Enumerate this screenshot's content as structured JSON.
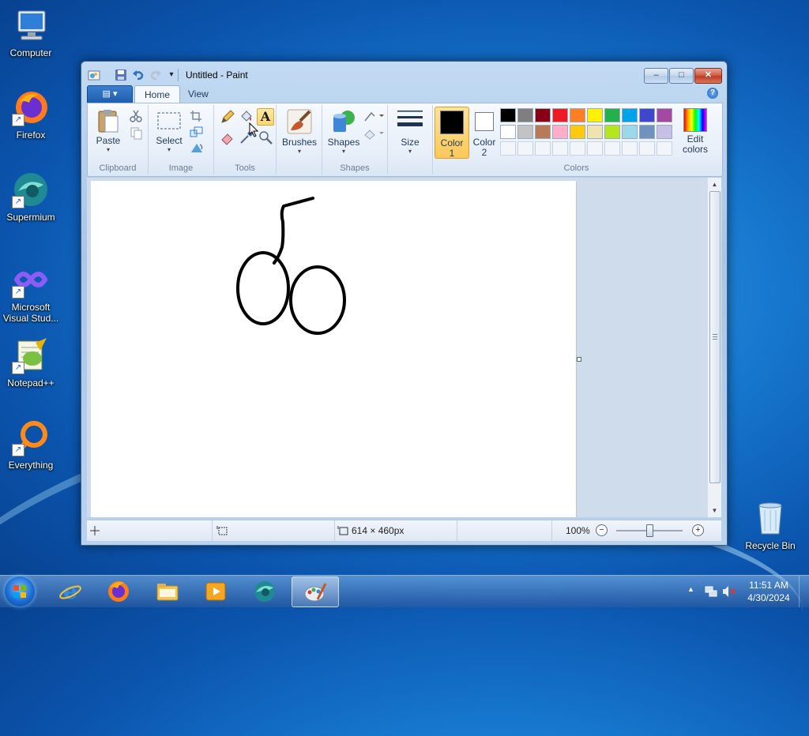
{
  "desktop": {
    "icons": [
      {
        "id": "computer",
        "label": "Computer"
      },
      {
        "id": "firefox",
        "label": "Firefox"
      },
      {
        "id": "supermium",
        "label": "Supermium"
      },
      {
        "id": "vs",
        "label": "Microsoft Visual Stud..."
      },
      {
        "id": "notepadpp",
        "label": "Notepad++"
      },
      {
        "id": "everything",
        "label": "Everything"
      },
      {
        "id": "recycle",
        "label": "Recycle Bin"
      }
    ]
  },
  "window": {
    "title": "Untitled - Paint",
    "caption_buttons": {
      "minimize": "–",
      "maximize": "□",
      "close": "✕"
    },
    "tabs": {
      "file": "▤ ▾",
      "home": "Home",
      "view": "View"
    },
    "help": "?"
  },
  "ribbon": {
    "clipboard": {
      "paste": "Paste",
      "label": "Clipboard"
    },
    "image": {
      "select": "Select",
      "label": "Image"
    },
    "tools": {
      "label": "Tools",
      "text_tool": "A"
    },
    "brushes": {
      "label": "Brushes"
    },
    "shapes": {
      "shapes_btn": "Shapes",
      "label": "Shapes"
    },
    "size": {
      "label": "Size"
    },
    "colors": {
      "color1_label": "Color 1",
      "color2_label": "Color 2",
      "color1": "#000000",
      "color2": "#ffffff",
      "edit_colors": "Edit colors",
      "label": "Colors",
      "palette_row1": [
        "#000000",
        "#7f7f7f",
        "#880015",
        "#ed1c24",
        "#ff7f27",
        "#fff200",
        "#22b14c",
        "#00a2e8",
        "#3f48cc",
        "#a349a4"
      ],
      "palette_row2": [
        "#ffffff",
        "#c3c3c3",
        "#b97a57",
        "#ffaec9",
        "#ffc90e",
        "#efe4b0",
        "#b5e61d",
        "#99d9ea",
        "#7092be",
        "#c8bfe7"
      ]
    }
  },
  "status": {
    "dimensions": "614 × 460px",
    "zoom": "100%",
    "zoom_minus": "−",
    "zoom_plus": "+",
    "zoom_level": 0.5
  },
  "taskbar": {
    "items": [
      "internet-explorer",
      "firefox",
      "file-explorer",
      "media-player",
      "supermium",
      "paint"
    ],
    "time": "11:51 AM",
    "date": "4/30/2024"
  }
}
